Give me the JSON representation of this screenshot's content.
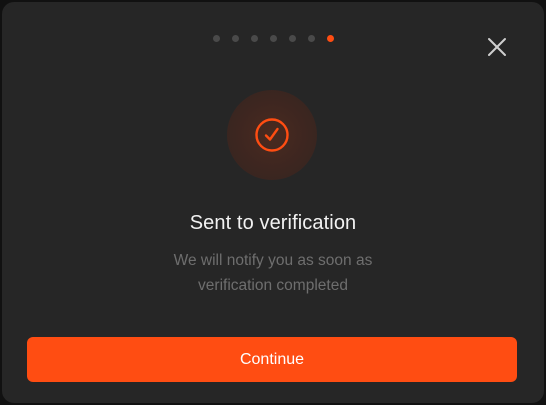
{
  "dialog": {
    "title": "Sent to verification",
    "message_line1": "We will notify you as soon as",
    "message_line2": "verification completed",
    "continue_label": "Continue"
  },
  "stepper": {
    "total_steps": 7,
    "current_step": 7
  },
  "icons": {
    "close": "close-icon",
    "status": "check-circle-icon"
  },
  "colors": {
    "accent": "#ff4d12",
    "background": "#262626",
    "inactive_dot": "#4a4a4a"
  }
}
